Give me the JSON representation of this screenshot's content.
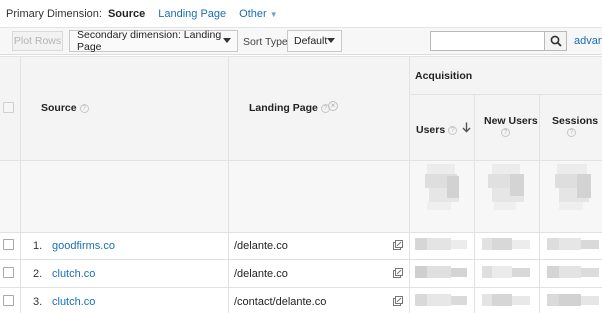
{
  "primary_dimension": {
    "label": "Primary Dimension:",
    "options": [
      "Source",
      "Landing Page",
      "Other"
    ],
    "active": "Source"
  },
  "toolbar": {
    "plot_rows": "Plot Rows",
    "secondary_dimension": "Secondary dimension: Landing Page",
    "sort_type_label": "Sort Type:",
    "sort_type_value": "Default",
    "search_placeholder": "",
    "advanced_label": "advanced"
  },
  "table": {
    "group_header": "Acquisition",
    "columns": {
      "source": "Source",
      "landing_page": "Landing Page",
      "users": "Users",
      "new_users": "New Users",
      "sessions": "Sessions"
    },
    "rows": [
      {
        "num": "1.",
        "source": "goodfirms.co",
        "landing_page": "/delante.co"
      },
      {
        "num": "2.",
        "source": "clutch.co",
        "landing_page": "/delante.co"
      },
      {
        "num": "3.",
        "source": "clutch.co",
        "landing_page": "/contact/delante.co"
      }
    ]
  },
  "colors": {
    "link": "#1a6fb5",
    "header_bg": "#f4f4f4",
    "toolbar_bg": "#f7f7f7"
  }
}
